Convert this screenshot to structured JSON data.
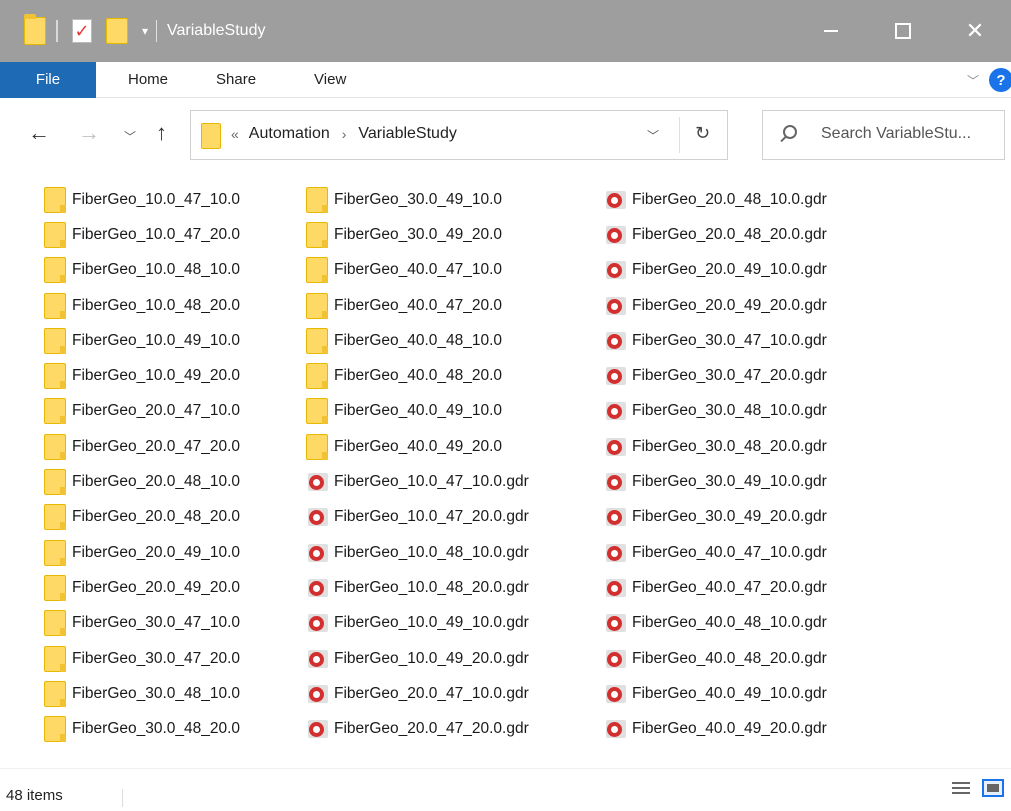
{
  "window": {
    "title": "VariableStudy",
    "controls": {
      "minimize": "—",
      "maximize": "☐",
      "close": "✕"
    }
  },
  "ribbon": {
    "tabs": [
      {
        "label": "File"
      },
      {
        "label": "Home"
      },
      {
        "label": "Share"
      },
      {
        "label": "View"
      }
    ],
    "help_label": "?"
  },
  "address": {
    "prefix": "«",
    "crumbs": [
      "Automation",
      "VariableStudy"
    ],
    "separator": "›"
  },
  "search": {
    "placeholder": "Search VariableStu..."
  },
  "files": {
    "column1": [
      {
        "name": "FiberGeo_10.0_47_10.0",
        "type": "folder"
      },
      {
        "name": "FiberGeo_10.0_47_20.0",
        "type": "folder"
      },
      {
        "name": "FiberGeo_10.0_48_10.0",
        "type": "folder"
      },
      {
        "name": "FiberGeo_10.0_48_20.0",
        "type": "folder"
      },
      {
        "name": "FiberGeo_10.0_49_10.0",
        "type": "folder"
      },
      {
        "name": "FiberGeo_10.0_49_20.0",
        "type": "folder"
      },
      {
        "name": "FiberGeo_20.0_47_10.0",
        "type": "folder"
      },
      {
        "name": "FiberGeo_20.0_47_20.0",
        "type": "folder"
      },
      {
        "name": "FiberGeo_20.0_48_10.0",
        "type": "folder"
      },
      {
        "name": "FiberGeo_20.0_48_20.0",
        "type": "folder"
      },
      {
        "name": "FiberGeo_20.0_49_10.0",
        "type": "folder"
      },
      {
        "name": "FiberGeo_20.0_49_20.0",
        "type": "folder"
      },
      {
        "name": "FiberGeo_30.0_47_10.0",
        "type": "folder"
      },
      {
        "name": "FiberGeo_30.0_47_20.0",
        "type": "folder"
      },
      {
        "name": "FiberGeo_30.0_48_10.0",
        "type": "folder"
      },
      {
        "name": "FiberGeo_30.0_48_20.0",
        "type": "folder"
      }
    ],
    "column2": [
      {
        "name": "FiberGeo_30.0_49_10.0",
        "type": "folder"
      },
      {
        "name": "FiberGeo_30.0_49_20.0",
        "type": "folder"
      },
      {
        "name": "FiberGeo_40.0_47_10.0",
        "type": "folder"
      },
      {
        "name": "FiberGeo_40.0_47_20.0",
        "type": "folder"
      },
      {
        "name": "FiberGeo_40.0_48_10.0",
        "type": "folder"
      },
      {
        "name": "FiberGeo_40.0_48_20.0",
        "type": "folder"
      },
      {
        "name": "FiberGeo_40.0_49_10.0",
        "type": "folder"
      },
      {
        "name": "FiberGeo_40.0_49_20.0",
        "type": "folder"
      },
      {
        "name": "FiberGeo_10.0_47_10.0.gdr",
        "type": "gdr"
      },
      {
        "name": "FiberGeo_10.0_47_20.0.gdr",
        "type": "gdr"
      },
      {
        "name": "FiberGeo_10.0_48_10.0.gdr",
        "type": "gdr"
      },
      {
        "name": "FiberGeo_10.0_48_20.0.gdr",
        "type": "gdr"
      },
      {
        "name": "FiberGeo_10.0_49_10.0.gdr",
        "type": "gdr"
      },
      {
        "name": "FiberGeo_10.0_49_20.0.gdr",
        "type": "gdr"
      },
      {
        "name": "FiberGeo_20.0_47_10.0.gdr",
        "type": "gdr"
      },
      {
        "name": "FiberGeo_20.0_47_20.0.gdr",
        "type": "gdr"
      }
    ],
    "column3": [
      {
        "name": "FiberGeo_20.0_48_10.0.gdr",
        "type": "gdr"
      },
      {
        "name": "FiberGeo_20.0_48_20.0.gdr",
        "type": "gdr"
      },
      {
        "name": "FiberGeo_20.0_49_10.0.gdr",
        "type": "gdr"
      },
      {
        "name": "FiberGeo_20.0_49_20.0.gdr",
        "type": "gdr"
      },
      {
        "name": "FiberGeo_30.0_47_10.0.gdr",
        "type": "gdr"
      },
      {
        "name": "FiberGeo_30.0_47_20.0.gdr",
        "type": "gdr"
      },
      {
        "name": "FiberGeo_30.0_48_10.0.gdr",
        "type": "gdr"
      },
      {
        "name": "FiberGeo_30.0_48_20.0.gdr",
        "type": "gdr"
      },
      {
        "name": "FiberGeo_30.0_49_10.0.gdr",
        "type": "gdr"
      },
      {
        "name": "FiberGeo_30.0_49_20.0.gdr",
        "type": "gdr"
      },
      {
        "name": "FiberGeo_40.0_47_10.0.gdr",
        "type": "gdr"
      },
      {
        "name": "FiberGeo_40.0_47_20.0.gdr",
        "type": "gdr"
      },
      {
        "name": "FiberGeo_40.0_48_10.0.gdr",
        "type": "gdr"
      },
      {
        "name": "FiberGeo_40.0_48_20.0.gdr",
        "type": "gdr"
      },
      {
        "name": "FiberGeo_40.0_49_10.0.gdr",
        "type": "gdr"
      },
      {
        "name": "FiberGeo_40.0_49_20.0.gdr",
        "type": "gdr"
      }
    ]
  },
  "status": {
    "item_count": "48 items"
  },
  "colors": {
    "titlebar_bg": "#9e9e9e",
    "file_tab_bg": "#1f6ab5",
    "folder_yellow": "#ffd966",
    "gdr_red": "#d32f2f",
    "help_blue": "#1a73e8"
  }
}
